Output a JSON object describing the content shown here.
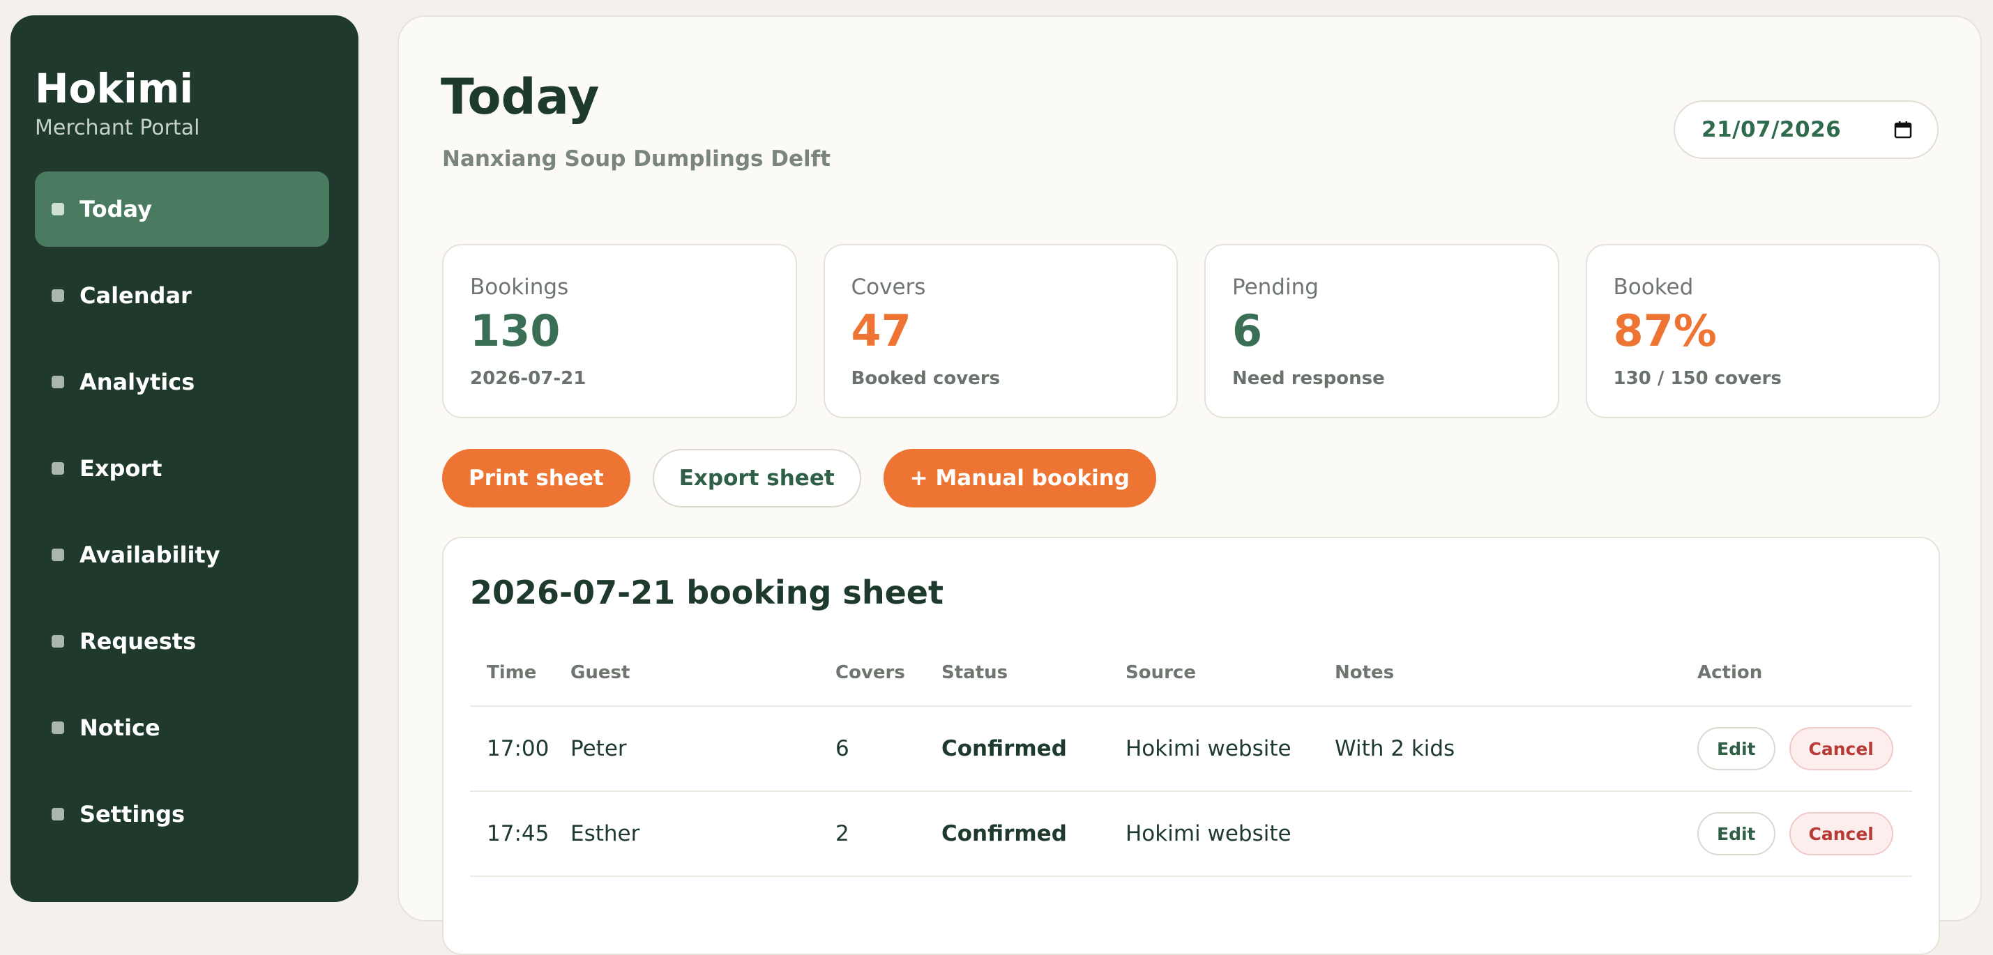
{
  "brand": {
    "name": "Hokimi",
    "subtitle": "Merchant Portal"
  },
  "sidebar": {
    "items": [
      {
        "label": "Today",
        "active": true
      },
      {
        "label": "Calendar",
        "active": false
      },
      {
        "label": "Analytics",
        "active": false
      },
      {
        "label": "Export",
        "active": false
      },
      {
        "label": "Availability",
        "active": false
      },
      {
        "label": "Requests",
        "active": false
      },
      {
        "label": "Notice",
        "active": false
      },
      {
        "label": "Settings",
        "active": false
      }
    ]
  },
  "header": {
    "title": "Today",
    "subtitle": "Nanxiang Soup Dumplings Delft",
    "date_value": "21/07/2026"
  },
  "stats": [
    {
      "label": "Bookings",
      "value": "130",
      "note": "2026-07-21",
      "color": "green"
    },
    {
      "label": "Covers",
      "value": "47",
      "note": "Booked covers",
      "color": "orange"
    },
    {
      "label": "Pending",
      "value": "6",
      "note": "Need response",
      "color": "green"
    },
    {
      "label": "Booked",
      "value": "87%",
      "note": "130 / 150 covers",
      "color": "orange"
    }
  ],
  "actions": {
    "print": "Print sheet",
    "export": "Export sheet",
    "manual": "+ Manual booking"
  },
  "sheet": {
    "title": "2026-07-21 booking sheet",
    "columns": [
      "Time",
      "Guest",
      "Covers",
      "Status",
      "Source",
      "Notes",
      "Action"
    ],
    "rows": [
      {
        "time": "17:00",
        "guest": "Peter",
        "covers": "6",
        "status": "Confirmed",
        "source": "Hokimi website",
        "notes": "With 2 kids",
        "edit": "Edit",
        "cancel": "Cancel"
      },
      {
        "time": "17:45",
        "guest": "Esther",
        "covers": "2",
        "status": "Confirmed",
        "source": "Hokimi website",
        "notes": "",
        "edit": "Edit",
        "cancel": "Cancel"
      }
    ]
  },
  "colors": {
    "sidebar_bg": "#1f3a2d",
    "active_nav": "#4a7a5f",
    "accent_orange": "#ee7433",
    "accent_green": "#3a6f55",
    "cancel_red": "#b83a34"
  },
  "icons": {
    "date_picker": "calendar-icon",
    "nav_bullet": "square-bullet-icon"
  }
}
